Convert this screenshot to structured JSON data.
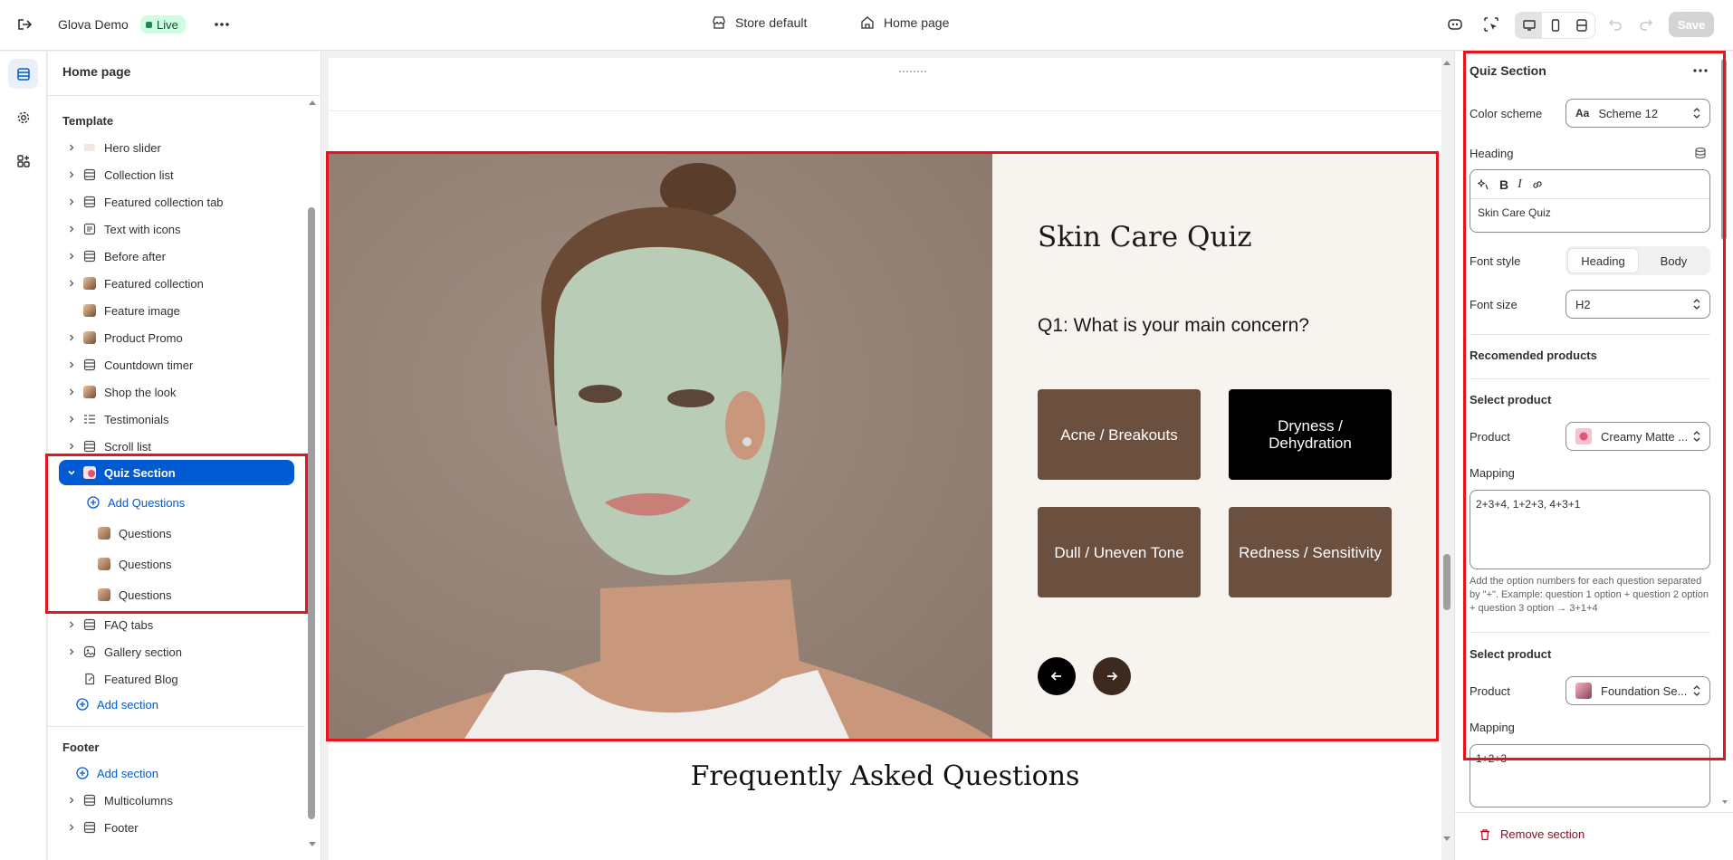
{
  "topbar": {
    "store_name": "Glova Demo",
    "live_badge": "Live",
    "theme_label": "Store default",
    "page_label": "Home page",
    "save_label": "Save"
  },
  "left_panel": {
    "title": "Home page",
    "template_heading": "Template",
    "sections": [
      {
        "label": "Hero slider",
        "icon": "hero-thumb-icon"
      },
      {
        "label": "Collection list",
        "icon": "layout-section-icon"
      },
      {
        "label": "Featured collection tab",
        "icon": "layout-section-icon"
      },
      {
        "label": "Text with icons",
        "icon": "text-block-icon"
      },
      {
        "label": "Before after",
        "icon": "layout-section-icon"
      },
      {
        "label": "Featured collection",
        "icon": "image-thumb-icon"
      },
      {
        "label": "Feature image",
        "icon": "image-thumb-icon"
      },
      {
        "label": "Product Promo",
        "icon": "image-thumb-icon"
      },
      {
        "label": "Countdown timer",
        "icon": "layout-section-icon"
      },
      {
        "label": "Shop the look",
        "icon": "image-thumb-icon"
      },
      {
        "label": "Testimonials",
        "icon": "list-icon"
      },
      {
        "label": "Scroll list",
        "icon": "layout-section-icon"
      }
    ],
    "selected_section": "Quiz Section",
    "add_questions": "Add Questions",
    "questions": [
      "Questions",
      "Questions",
      "Questions"
    ],
    "after_sections": [
      {
        "label": "FAQ tabs",
        "icon": "layout-section-icon"
      },
      {
        "label": "Gallery section",
        "icon": "gallery-icon"
      },
      {
        "label": "Featured Blog",
        "icon": "blog-icon"
      }
    ],
    "add_section": "Add section",
    "footer_heading": "Footer",
    "footer_add_section": "Add section",
    "footer_sections": [
      {
        "label": "Multicolumns",
        "icon": "layout-section-icon"
      },
      {
        "label": "Footer",
        "icon": "layout-section-icon"
      }
    ]
  },
  "preview": {
    "quiz_title": "Skin Care Quiz",
    "question": "Q1: What is your main concern?",
    "options": [
      "Acne / Breakouts",
      "Dryness / Dehydration",
      "Dull / Uneven Tone",
      "Redness / Sensitivity"
    ],
    "faq_title": "Frequently Asked Questions",
    "colors": {
      "option_brown": "#6b4f3f",
      "option_selected": "#000000",
      "highlight": "#e5141f"
    }
  },
  "right_panel": {
    "title": "Quiz Section",
    "color_scheme_label": "Color scheme",
    "color_scheme_value": "Scheme 12",
    "heading_label": "Heading",
    "heading_value": "Skin Care Quiz",
    "font_style_label": "Font style",
    "font_style_options": [
      "Heading",
      "Body"
    ],
    "font_style_selected": "Heading",
    "font_size_label": "Font size",
    "font_size_value": "H2",
    "recommended_heading": "Recomended products",
    "select_product_1": "Select product",
    "product_label_1": "Product",
    "product_value_1": "Creamy Matte ...",
    "mapping_label_1": "Mapping",
    "mapping_value_1": "2+3+4, 1+2+3, 4+3+1",
    "mapping_help": "Add the option numbers for each question separated by \"+\". Example: question 1 option + question 2 option + question 3 option → 3+1+4",
    "select_product_2": "Select product",
    "product_label_2": "Product",
    "product_value_2": "Foundation Se...",
    "mapping_label_2": "Mapping",
    "mapping_value_2": "1+2+3",
    "remove_section": "Remove section"
  }
}
